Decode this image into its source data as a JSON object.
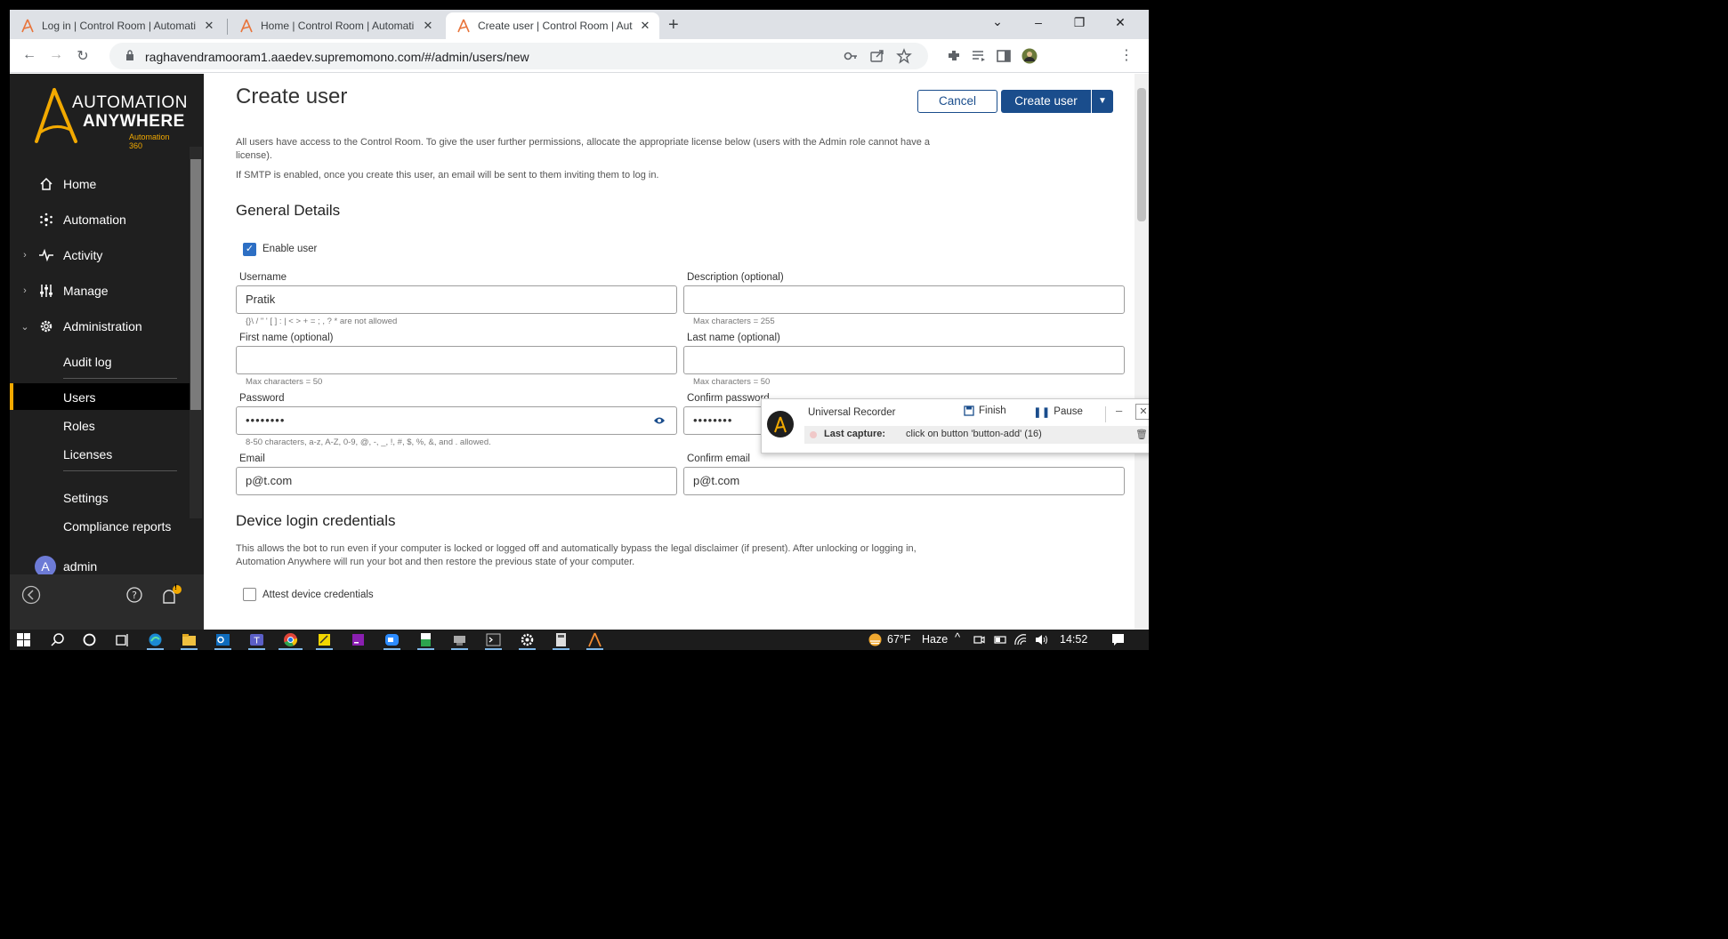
{
  "browser": {
    "tabs": [
      {
        "title": "Log in | Control Room | Automati"
      },
      {
        "title": "Home | Control Room | Automati"
      },
      {
        "title": "Create user | Control Room | Aut"
      }
    ],
    "new_tab": "+",
    "url": "raghavendramooram1.aaedev.supremomono.com/#/admin/users/new"
  },
  "sidebar": {
    "logo_line1": "AUTOMATION",
    "logo_line2": "ANYWHERE",
    "logo_line3": "Automation 360",
    "items": [
      {
        "label": "Home",
        "icon": "home-icon"
      },
      {
        "label": "Automation",
        "icon": "automation-icon"
      },
      {
        "label": "Activity",
        "icon": "activity-icon"
      },
      {
        "label": "Manage",
        "icon": "manage-icon"
      },
      {
        "label": "Administration",
        "icon": "gear-icon"
      }
    ],
    "sub_items": [
      "Audit log",
      "Users",
      "Roles",
      "Licenses",
      "Settings",
      "Compliance reports"
    ],
    "user": {
      "initial": "A",
      "name": "admin"
    },
    "notif_badge": "!"
  },
  "page": {
    "title": "Create user",
    "cancel_label": "Cancel",
    "create_label": "Create user",
    "intro1": "All users have access to the Control Room. To give the user further permissions, allocate the appropriate license below (users with the Admin role cannot have a license).",
    "intro2": "If SMTP is enabled, once you create this user, an email will be sent to them inviting them to log in.",
    "general_heading": "General Details",
    "enable_user": "Enable user",
    "fields": {
      "username": {
        "label": "Username",
        "value": "Pratik",
        "hint": "{}\\ / \" ' [ ] : | < > + = ; , ? *  are not allowed"
      },
      "description": {
        "label": "Description (optional)",
        "value": "",
        "hint": "Max characters = 255"
      },
      "first_name": {
        "label": "First name (optional)",
        "value": "",
        "hint": "Max characters = 50"
      },
      "last_name": {
        "label": "Last name (optional)",
        "value": "",
        "hint": "Max characters = 50"
      },
      "password": {
        "label": "Password",
        "value": "••••••••",
        "hint": "8-50 characters, a-z, A-Z, 0-9, @, -, _, !, #, $, %, &, and . allowed."
      },
      "confirm_password": {
        "label": "Confirm password",
        "value": "••••••••"
      },
      "email": {
        "label": "Email",
        "value": "p@t.com"
      },
      "confirm_email": {
        "label": "Confirm email",
        "value": "p@t.com"
      }
    },
    "device_heading": "Device login credentials",
    "device_text": "This allows the bot to run even if your computer is locked or logged off and automatically bypass the legal disclaimer (if present). After unlocking or logging in, Automation Anywhere will run your bot and then restore the previous state of your computer.",
    "attest_label": "Attest device credentials"
  },
  "recorder": {
    "title": "Universal Recorder",
    "finish_label": "Finish",
    "pause_label": "Pause",
    "last_capture_label": "Last capture:",
    "last_capture_value": "click on button 'button-add' (16)"
  },
  "taskbar": {
    "weather_temp": "67°F",
    "weather_desc": "Haze",
    "time": "14:52"
  },
  "colors": {
    "brand_orange": "#f2a900",
    "primary_blue": "#1a4d8c",
    "sidebar_bg": "#1f1f1f"
  }
}
